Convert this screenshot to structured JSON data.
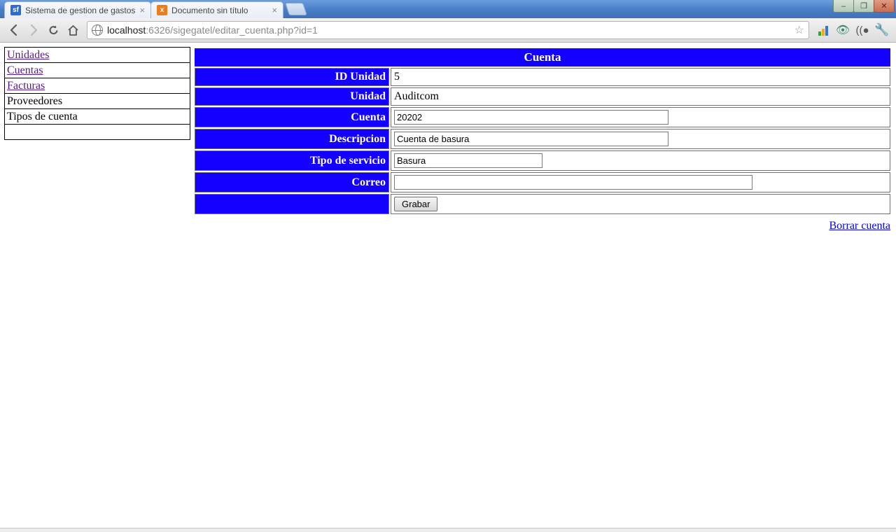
{
  "window": {
    "tabs": [
      {
        "title": "Sistema de gestion de gastos"
      },
      {
        "title": "Documento sin título"
      }
    ],
    "buttons": {
      "minimize": "–",
      "maximize": "❐",
      "close": "✕"
    }
  },
  "toolbar": {
    "url_host": "localhost",
    "url_rest": ":6326/sigegatel/editar_cuenta.php?id=1"
  },
  "sidebar": {
    "items": [
      {
        "label": "Unidades",
        "link": true,
        "visited": true
      },
      {
        "label": "Cuentas",
        "link": true,
        "visited": true
      },
      {
        "label": "Facturas",
        "link": true,
        "visited": true
      },
      {
        "label": "Proveedores",
        "link": false
      },
      {
        "label": "Tipos de cuenta",
        "link": false
      },
      {
        "label": "",
        "link": false
      }
    ]
  },
  "form": {
    "title": "Cuenta",
    "fields": {
      "id_unidad": {
        "label": "ID Unidad",
        "value": "5"
      },
      "unidad": {
        "label": "Unidad",
        "value": "Auditcom"
      },
      "cuenta": {
        "label": "Cuenta",
        "value": "20202"
      },
      "descripcion": {
        "label": "Descripcion",
        "value": "Cuenta de basura"
      },
      "tipo_de_servicio": {
        "label": "Tipo de servicio",
        "value": "Basura"
      },
      "correo": {
        "label": "Correo",
        "value": ""
      }
    },
    "submit_label": "Grabar",
    "delete_label": "Borrar cuenta"
  }
}
